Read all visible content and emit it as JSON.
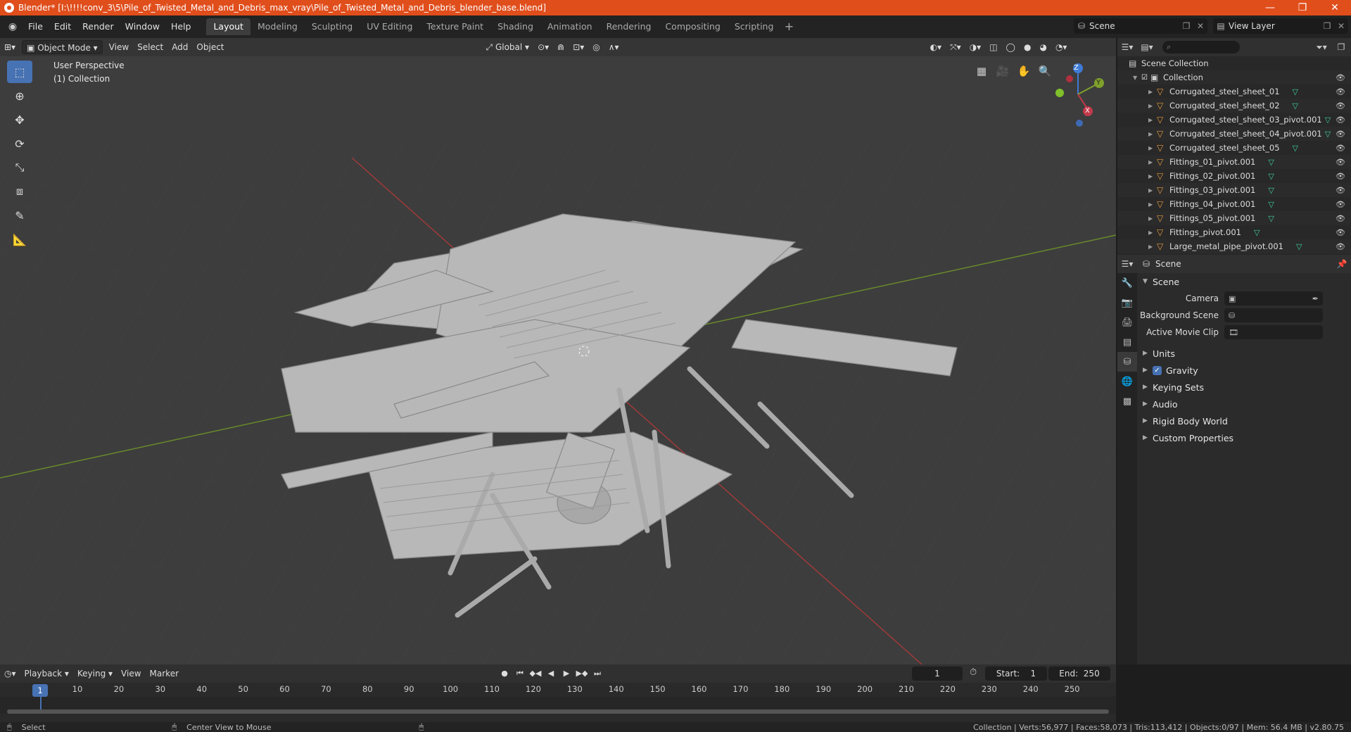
{
  "titlebar": {
    "title": "Blender* [I:\\!!!!conv_3\\5\\Pile_of_Twisted_Metal_and_Debris_max_vray\\Pile_of_Twisted_Metal_and_Debris_blender_base.blend]",
    "minimize": "—",
    "maximize": "❐",
    "close": "✕"
  },
  "menubar": {
    "items": [
      "File",
      "Edit",
      "Render",
      "Window",
      "Help"
    ],
    "workspaces": [
      "Layout",
      "Modeling",
      "Sculpting",
      "UV Editing",
      "Texture Paint",
      "Shading",
      "Animation",
      "Rendering",
      "Compositing",
      "Scripting"
    ],
    "active_workspace": "Layout",
    "scene": "Scene",
    "view_layer": "View Layer"
  },
  "viewport": {
    "mode": "Object Mode",
    "menus": [
      "View",
      "Select",
      "Add",
      "Object"
    ],
    "transform_orientation": "Global",
    "overlay_line1": "User Perspective",
    "overlay_line2": "(1) Collection",
    "gizmo_axes": {
      "x": "X",
      "y": "Y",
      "z": "Z"
    }
  },
  "outliner": {
    "search_placeholder": "",
    "scene_collection": "Scene Collection",
    "collection": "Collection",
    "objects": [
      "Corrugated_steel_sheet_01",
      "Corrugated_steel_sheet_02",
      "Corrugated_steel_sheet_03_pivot.001",
      "Corrugated_steel_sheet_04_pivot.001",
      "Corrugated_steel_sheet_05",
      "Fittings_01_pivot.001",
      "Fittings_02_pivot.001",
      "Fittings_03_pivot.001",
      "Fittings_04_pivot.001",
      "Fittings_05_pivot.001",
      "Fittings_pivot.001",
      "Large_metal_pipe_pivot.001"
    ]
  },
  "properties": {
    "context": "Scene",
    "panel_scene": "Scene",
    "camera_label": "Camera",
    "background_scene_label": "Background Scene",
    "active_movie_clip_label": "Active Movie Clip",
    "subpanels": [
      "Units",
      "Gravity",
      "Keying Sets",
      "Audio",
      "Rigid Body World",
      "Custom Properties"
    ],
    "gravity_checked": true
  },
  "timeline": {
    "menus": [
      "Playback",
      "Keying",
      "View",
      "Marker"
    ],
    "current_frame": "1",
    "start_label": "Start:",
    "start": "1",
    "end_label": "End:",
    "end": "250",
    "ticks": [
      "10",
      "20",
      "30",
      "40",
      "50",
      "60",
      "70",
      "80",
      "90",
      "100",
      "110",
      "120",
      "130",
      "140",
      "150",
      "160",
      "170",
      "180",
      "190",
      "200",
      "210",
      "220",
      "230",
      "240",
      "250"
    ]
  },
  "statusbar": {
    "select": "Select",
    "center_view": "Center View to Mouse",
    "stats": "Collection | Verts:56,977 | Faces:58,073 | Tris:113,412 | Objects:0/97 | Mem: 56.4 MB | v2.80.75"
  },
  "colors": {
    "title_accent": "#e04e1c",
    "active_blue": "#4772b3",
    "object_orange": "#e89b3f",
    "mesh_green": "#3fd0a0"
  }
}
